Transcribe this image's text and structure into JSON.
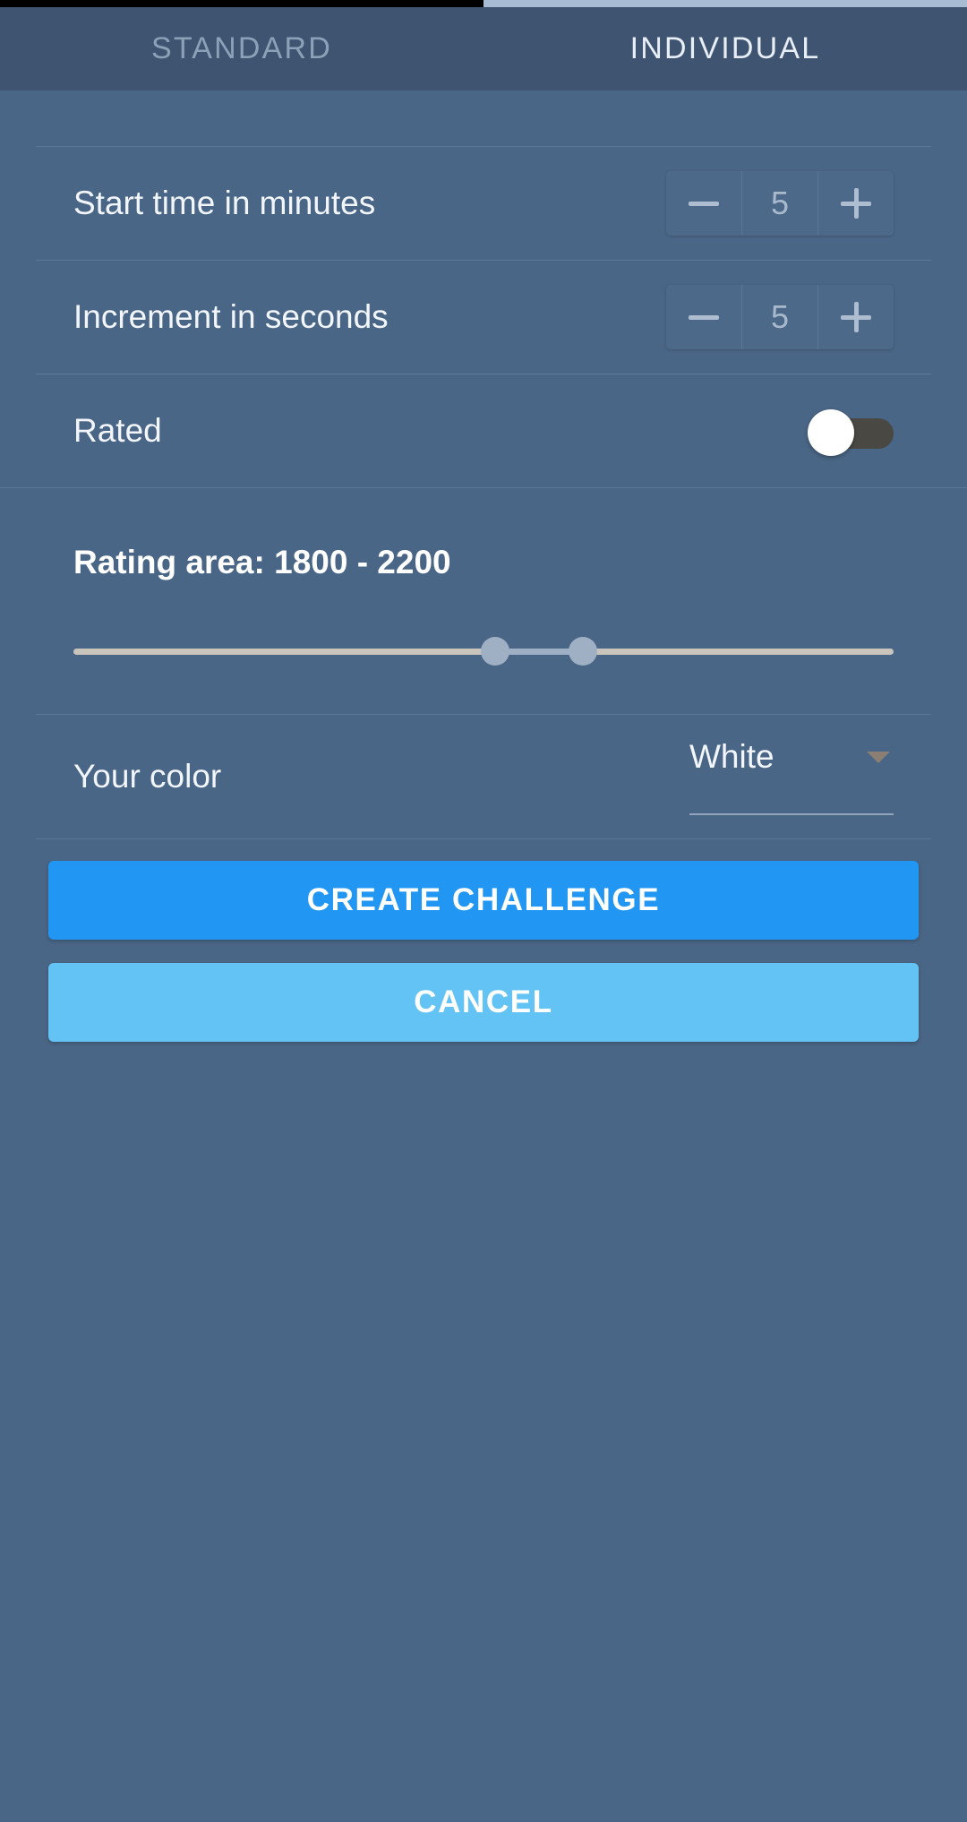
{
  "status_strip": {
    "left_color": "#000000",
    "indicator_color": "#a8bdd4"
  },
  "tabs": [
    {
      "label": "STANDARD",
      "active": false
    },
    {
      "label": "INDIVIDUAL",
      "active": true
    }
  ],
  "settings": {
    "start_time": {
      "label": "Start time in minutes",
      "value": "5",
      "minus": "−",
      "plus": "+"
    },
    "increment": {
      "label": "Increment in seconds",
      "value": "5",
      "minus": "−",
      "plus": "+"
    },
    "rated": {
      "label": "Rated",
      "state": "off",
      "track_color": "#4a4843",
      "knob_color": "#ffffff"
    }
  },
  "rating_area": {
    "title": "Rating area: 1800 - 2200",
    "min_value": 1800,
    "max_value": 2200,
    "track_color": "#c9c5bc",
    "thumb_color": "#9fb0c4"
  },
  "your_color": {
    "label": "Your color",
    "value": "White",
    "caret": "dropdown-caret"
  },
  "actions": {
    "create": "CREATE CHALLENGE",
    "cancel": "CANCEL",
    "create_color": "#2196f3",
    "cancel_color": "#64c3f5"
  }
}
